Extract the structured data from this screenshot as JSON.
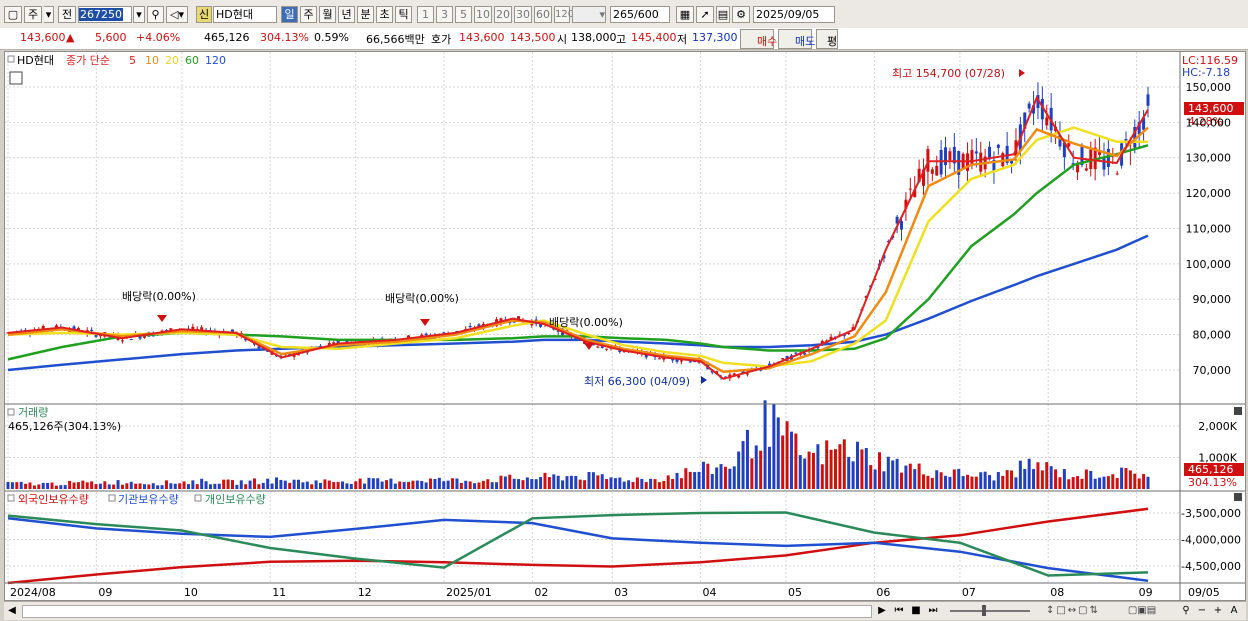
{
  "toolbar": {
    "period_label": "주",
    "prev_label": "전",
    "code_value": "267250",
    "stock_name": "HD현대",
    "market_badge": "신",
    "periods": [
      "일",
      "주",
      "월",
      "년",
      "분",
      "초",
      "틱"
    ],
    "intervals": [
      "1",
      "3",
      "5",
      "10",
      "20",
      "30",
      "60",
      "120"
    ],
    "count_value": "265",
    "count_total": "/600",
    "date_value": "2025/09/05"
  },
  "quote": {
    "price": "143,600",
    "change": "5,600",
    "change_pct": "+4.06%",
    "volume": "465,126",
    "volume_ratio": "304.13%",
    "turnover": "0.59%",
    "trade_value": "66,566백만",
    "ask_label": "호가",
    "ask_price": "143,600",
    "bid_price": "143,500",
    "open_label": "시",
    "open": "138,000",
    "high_label": "고",
    "high": "145,400",
    "low_label": "저",
    "low": "137,300",
    "buy_label": "매수",
    "sell_label": "매도",
    "avg_label": "평"
  },
  "price_panel": {
    "ticker": "HD현대",
    "legend_prefix": "종가 단순",
    "ma_periods": [
      {
        "label": "5",
        "color": "#e02020"
      },
      {
        "label": "10",
        "color": "#f08a10"
      },
      {
        "label": "20",
        "color": "#f0e020"
      },
      {
        "label": "60",
        "color": "#20a020"
      },
      {
        "label": "120",
        "color": "#2050d0"
      }
    ],
    "lc_label": "LC:116.59",
    "hc_label": "HC:-7.18",
    "last_price_tag": "143,600",
    "last_pct_tag": "4.28%",
    "annotations": {
      "high": "최고 154,700 (07/28)",
      "low": "최저 66,300 (04/09)",
      "dividend": "배당락(0.00%)"
    }
  },
  "volume_panel": {
    "title": "거래량",
    "summary": "465,126주(304.13%)",
    "last_tag": "465,126",
    "last_pct_tag": "304.13%"
  },
  "holdings_panel": {
    "legend": [
      "외국인보유수량",
      "기관보유수량",
      "개인보유수량"
    ]
  },
  "colors": {
    "up": "#d01010",
    "down": "#2040c0",
    "ma5": "#e02020",
    "ma10": "#f08a10",
    "ma20": "#f0e020",
    "ma60": "#20a020",
    "ma120": "#2050d0",
    "foreign": "#d01010",
    "inst": "#2050d0",
    "indiv": "#2a8a5a"
  },
  "chart_data": [
    {
      "type": "line",
      "name_print": "HD현대 종가 단순",
      "ylim": [
        62000,
        160000
      ],
      "y_ticks": [
        "70,000",
        "80,000",
        "90,000",
        "100,000",
        "110,000",
        "120,000",
        "130,000",
        "140,000",
        "150,000"
      ],
      "x_ticks": [
        "2024/08",
        "09",
        "10",
        "11",
        "12",
        "2025/01",
        "02",
        "03",
        "04",
        "05",
        "06",
        "07",
        "08",
        "09",
        "09/05"
      ],
      "x": [
        "2024/08/01",
        "2024/08/20",
        "2024/09/10",
        "2024/10/01",
        "2024/10/20",
        "2024/11/05",
        "2024/11/25",
        "2024/12/15",
        "2025/01/05",
        "2025/01/25",
        "2025/02/05",
        "2025/02/20",
        "2025/03/05",
        "2025/03/20",
        "2025/04/01",
        "2025/04/09",
        "2025/04/25",
        "2025/05/10",
        "2025/05/25",
        "2025/06/05",
        "2025/06/20",
        "2025/07/05",
        "2025/07/20",
        "2025/07/28",
        "2025/08/10",
        "2025/08/25",
        "2025/09/05"
      ],
      "series": [
        {
          "name": "5",
          "values": [
            80500,
            82000,
            79000,
            81500,
            80500,
            73500,
            77500,
            78500,
            80500,
            84500,
            83000,
            78000,
            75500,
            73500,
            72500,
            67500,
            71000,
            76000,
            81500,
            104000,
            129000,
            129000,
            131000,
            147000,
            130000,
            128500,
            143600
          ]
        },
        {
          "name": "10",
          "values": [
            80000,
            81500,
            79500,
            81000,
            80500,
            74500,
            77000,
            78000,
            80000,
            84000,
            83500,
            78500,
            76000,
            74000,
            73000,
            69500,
            70500,
            74500,
            79500,
            92000,
            122000,
            128000,
            129500,
            138000,
            134000,
            130500,
            138500
          ]
        },
        {
          "name": "20",
          "values": [
            80000,
            80500,
            80000,
            80500,
            80000,
            76500,
            76000,
            77500,
            79000,
            82500,
            84000,
            80000,
            77000,
            75000,
            74000,
            72000,
            71000,
            72500,
            77500,
            84000,
            112000,
            124000,
            128000,
            135000,
            138500,
            134500,
            134500
          ]
        },
        {
          "name": "60",
          "values": [
            73000,
            76500,
            79500,
            80500,
            80000,
            79500,
            78500,
            78500,
            78500,
            79000,
            79500,
            79500,
            79000,
            78500,
            77500,
            76500,
            75500,
            75500,
            76000,
            79000,
            90000,
            105000,
            114000,
            120000,
            128000,
            131000,
            133500
          ]
        },
        {
          "name": "120",
          "values": [
            70000,
            71500,
            73000,
            74500,
            75500,
            76000,
            76500,
            77000,
            77500,
            78000,
            78500,
            78500,
            78000,
            77500,
            77000,
            76500,
            76500,
            77000,
            78000,
            80000,
            84500,
            89500,
            94000,
            96500,
            100000,
            104000,
            108000
          ]
        }
      ],
      "annotations": [
        {
          "text": "최고 154,700 (07/28)",
          "x": "2025/07/28",
          "y": 154700
        },
        {
          "text": "최저 66,300 (04/09)",
          "x": "2025/04/09",
          "y": 66300
        }
      ]
    },
    {
      "type": "bar",
      "name_print": "거래량",
      "unit": "주",
      "y_ticks": [
        "1,000K",
        "2,000K"
      ],
      "ylim": [
        0,
        2500000
      ],
      "values_k": [
        180,
        160,
        200,
        220,
        190,
        240,
        210,
        280,
        230,
        260,
        250,
        300,
        260,
        320,
        360,
        420,
        330,
        300,
        560,
        760,
        2150,
        1000,
        1300,
        900,
        600,
        480,
        400,
        780,
        420,
        520,
        465
      ]
    },
    {
      "type": "line",
      "name_print": "외국인보유수량 / 기관보유수량 / 개인보유수량",
      "y_ticks": [
        "-3,500,000",
        "-4,000,000",
        "-4,500,000"
      ],
      "ylim": [
        -4900000,
        -3300000
      ],
      "x": [
        "2024/08",
        "2024/09",
        "2024/10",
        "2024/11",
        "2024/12",
        "2025/01",
        "2025/02",
        "2025/03",
        "2025/04",
        "2025/05",
        "2025/06",
        "2025/07",
        "2025/08",
        "2025/09"
      ],
      "series": [
        {
          "name": "외국인보유수량",
          "values": [
            -4820000,
            -4660000,
            -4520000,
            -4420000,
            -4400000,
            -4430000,
            -4480000,
            -4510000,
            -4430000,
            -4300000,
            -4060000,
            -3920000,
            -3660000,
            -3420000
          ]
        },
        {
          "name": "기관보유수량",
          "values": [
            -3600000,
            -3790000,
            -3890000,
            -3950000,
            -3800000,
            -3630000,
            -3690000,
            -3980000,
            -4060000,
            -4120000,
            -4060000,
            -4230000,
            -4540000,
            -4780000
          ]
        },
        {
          "name": "개인보유수량",
          "values": [
            -3550000,
            -3710000,
            -3830000,
            -4160000,
            -4360000,
            -4530000,
            -3600000,
            -3540000,
            -3500000,
            -3490000,
            -3870000,
            -4060000,
            -4680000,
            -4620000
          ]
        }
      ]
    }
  ]
}
